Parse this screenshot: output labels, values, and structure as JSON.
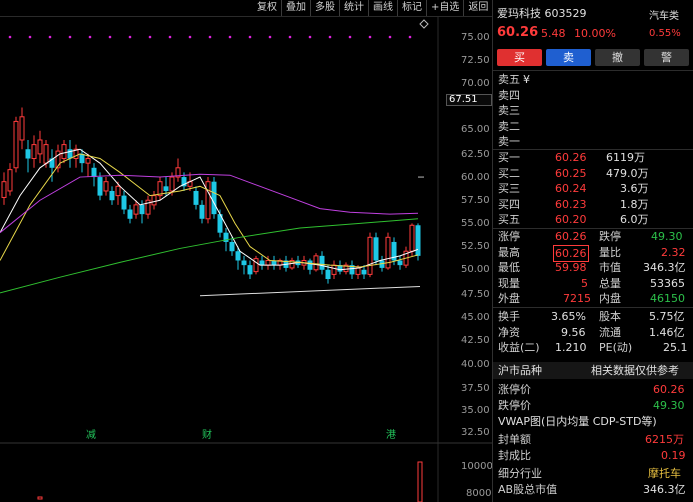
{
  "toolbar": {
    "items": [
      "复权",
      "叠加",
      "多股",
      "统计",
      "画线",
      "标记",
      "+自选",
      "返回"
    ]
  },
  "chart": {
    "y_axis_labels": [
      "75.00",
      "72.50",
      "70.00",
      "67.51",
      "65.00",
      "62.50",
      "60.00",
      "57.50",
      "55.00",
      "52.50",
      "50.00",
      "47.50",
      "45.00",
      "42.50",
      "40.00",
      "37.50",
      "35.00",
      "32.50"
    ],
    "price_marker": "67.51",
    "events": [
      {
        "label": "减"
      },
      {
        "label": "财"
      },
      {
        "label": "港"
      }
    ],
    "volume_axis_labels": [
      "10000",
      "8000"
    ],
    "colors": {
      "up": "#ff3b3b",
      "down": "#1ec8e6",
      "ma_white": "#ffffff",
      "ma_yellow": "#e8d84a",
      "ma_purple": "#c040e0",
      "ma_green": "#30c030",
      "dot": "#e020e0"
    }
  },
  "stock": {
    "name_code": "爱玛科技 603529",
    "price": "60.26",
    "change": "5.48",
    "change_pct": "10.00%",
    "sector": "汽车类",
    "sector_pct": "0.55%"
  },
  "buttons": {
    "buy": "买",
    "sell": "卖",
    "cancel": "撤",
    "warn": "警"
  },
  "sell_orders": [
    {
      "label": "卖五",
      "price": "",
      "vol": ""
    },
    {
      "label": "卖四",
      "price": "",
      "vol": ""
    },
    {
      "label": "卖三",
      "price": "",
      "vol": ""
    },
    {
      "label": "卖二",
      "price": "",
      "vol": ""
    },
    {
      "label": "卖一",
      "price": "",
      "vol": ""
    }
  ],
  "sell_mark": "¥",
  "buy_orders": [
    {
      "label": "买一",
      "price": "60.26",
      "vol": "6119万"
    },
    {
      "label": "买二",
      "price": "60.25",
      "vol": "479.0万"
    },
    {
      "label": "买三",
      "price": "60.24",
      "vol": "3.6万"
    },
    {
      "label": "买四",
      "price": "60.23",
      "vol": "1.8万"
    },
    {
      "label": "买五",
      "price": "60.20",
      "vol": "6.0万"
    }
  ],
  "stats": {
    "limit_up_label": "涨停",
    "limit_up": "60.26",
    "limit_down_label": "跌停",
    "limit_down": "49.30",
    "high_label": "最高",
    "high": "60.26",
    "vol_ratio_label": "量比",
    "vol_ratio": "2.32",
    "low_label": "最低",
    "low": "59.98",
    "mkt_cap_label": "市值",
    "mkt_cap": "346.3亿",
    "cur_vol_label": "现量",
    "cur_vol": "5",
    "total_vol_label": "总量",
    "total_vol": "53365",
    "outer_label": "外盘",
    "outer": "7215",
    "inner_label": "内盘",
    "inner": "46150",
    "turnover_label": "换手",
    "turnover": "3.65%",
    "shares_label": "股本",
    "shares": "5.75亿",
    "nav_label": "净资",
    "nav": "9.56",
    "float_label": "流通",
    "float": "1.46亿",
    "eps_label": "收益(二)",
    "eps": "1.210",
    "pe_label": "PE(动)",
    "pe": "25.1"
  },
  "section": {
    "market": "沪市品种",
    "note": "相关数据仅供参考"
  },
  "extra": {
    "up_price_label": "涨停价",
    "up_price": "60.26",
    "down_price_label": "跌停价",
    "down_price": "49.30",
    "vwap_label": "VWAP图(日内均量 CDP-STD等)",
    "seal_amt_label": "封单额",
    "seal_amt": "6215万",
    "seal_ratio_label": "封成比",
    "seal_ratio": "0.19",
    "industry_label": "细分行业",
    "industry": "摩托车",
    "ab_label": "AB股总市值",
    "ab": "346.3亿"
  }
}
